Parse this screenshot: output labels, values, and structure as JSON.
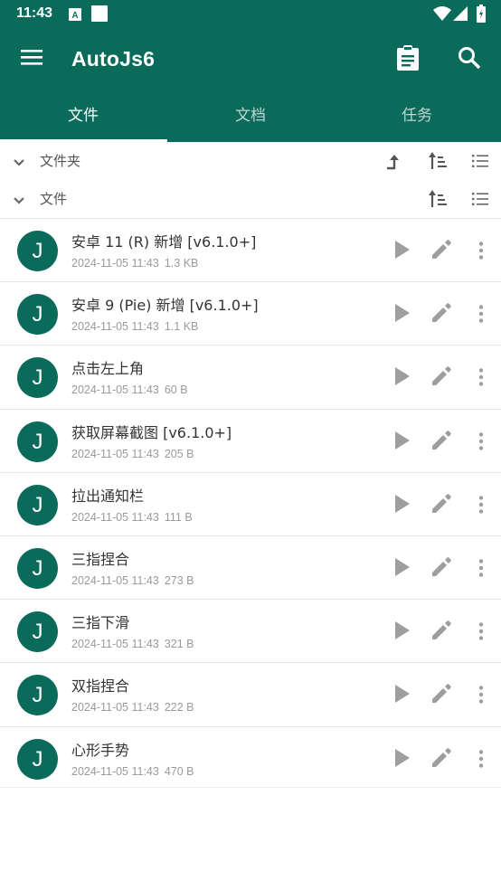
{
  "status_bar": {
    "time": "11:43"
  },
  "app_bar": {
    "title": "AutoJs6",
    "menu_icon": "menu-icon",
    "clipboard_icon": "clipboard-icon",
    "search_icon": "search-icon"
  },
  "tabs": [
    {
      "label": "文件",
      "active": true
    },
    {
      "label": "文档",
      "active": false
    },
    {
      "label": "任务",
      "active": false
    }
  ],
  "sections": {
    "folders_label": "文件夹",
    "files_label": "文件"
  },
  "files": [
    {
      "name": "安卓 11 (R) 新增 [v6.1.0+]",
      "date": "2024-11-05 11:43",
      "size": "1.3 KB",
      "avatar": "J"
    },
    {
      "name": "安卓 9 (Pie) 新增 [v6.1.0+]",
      "date": "2024-11-05 11:43",
      "size": "1.1 KB",
      "avatar": "J"
    },
    {
      "name": "点击左上角",
      "date": "2024-11-05 11:43",
      "size": "60 B",
      "avatar": "J"
    },
    {
      "name": "获取屏幕截图 [v6.1.0+]",
      "date": "2024-11-05 11:43",
      "size": "205 B",
      "avatar": "J"
    },
    {
      "name": "拉出通知栏",
      "date": "2024-11-05 11:43",
      "size": "111 B",
      "avatar": "J"
    },
    {
      "name": "三指捏合",
      "date": "2024-11-05 11:43",
      "size": "273 B",
      "avatar": "J"
    },
    {
      "name": "三指下滑",
      "date": "2024-11-05 11:43",
      "size": "321 B",
      "avatar": "J"
    },
    {
      "name": "双指捏合",
      "date": "2024-11-05 11:43",
      "size": "222 B",
      "avatar": "J"
    },
    {
      "name": "心形手势",
      "date": "2024-11-05 11:43",
      "size": "470 B",
      "avatar": "J"
    }
  ],
  "colors": {
    "primary": "#0b6b5a",
    "icon_gray": "#9e9e9e"
  }
}
